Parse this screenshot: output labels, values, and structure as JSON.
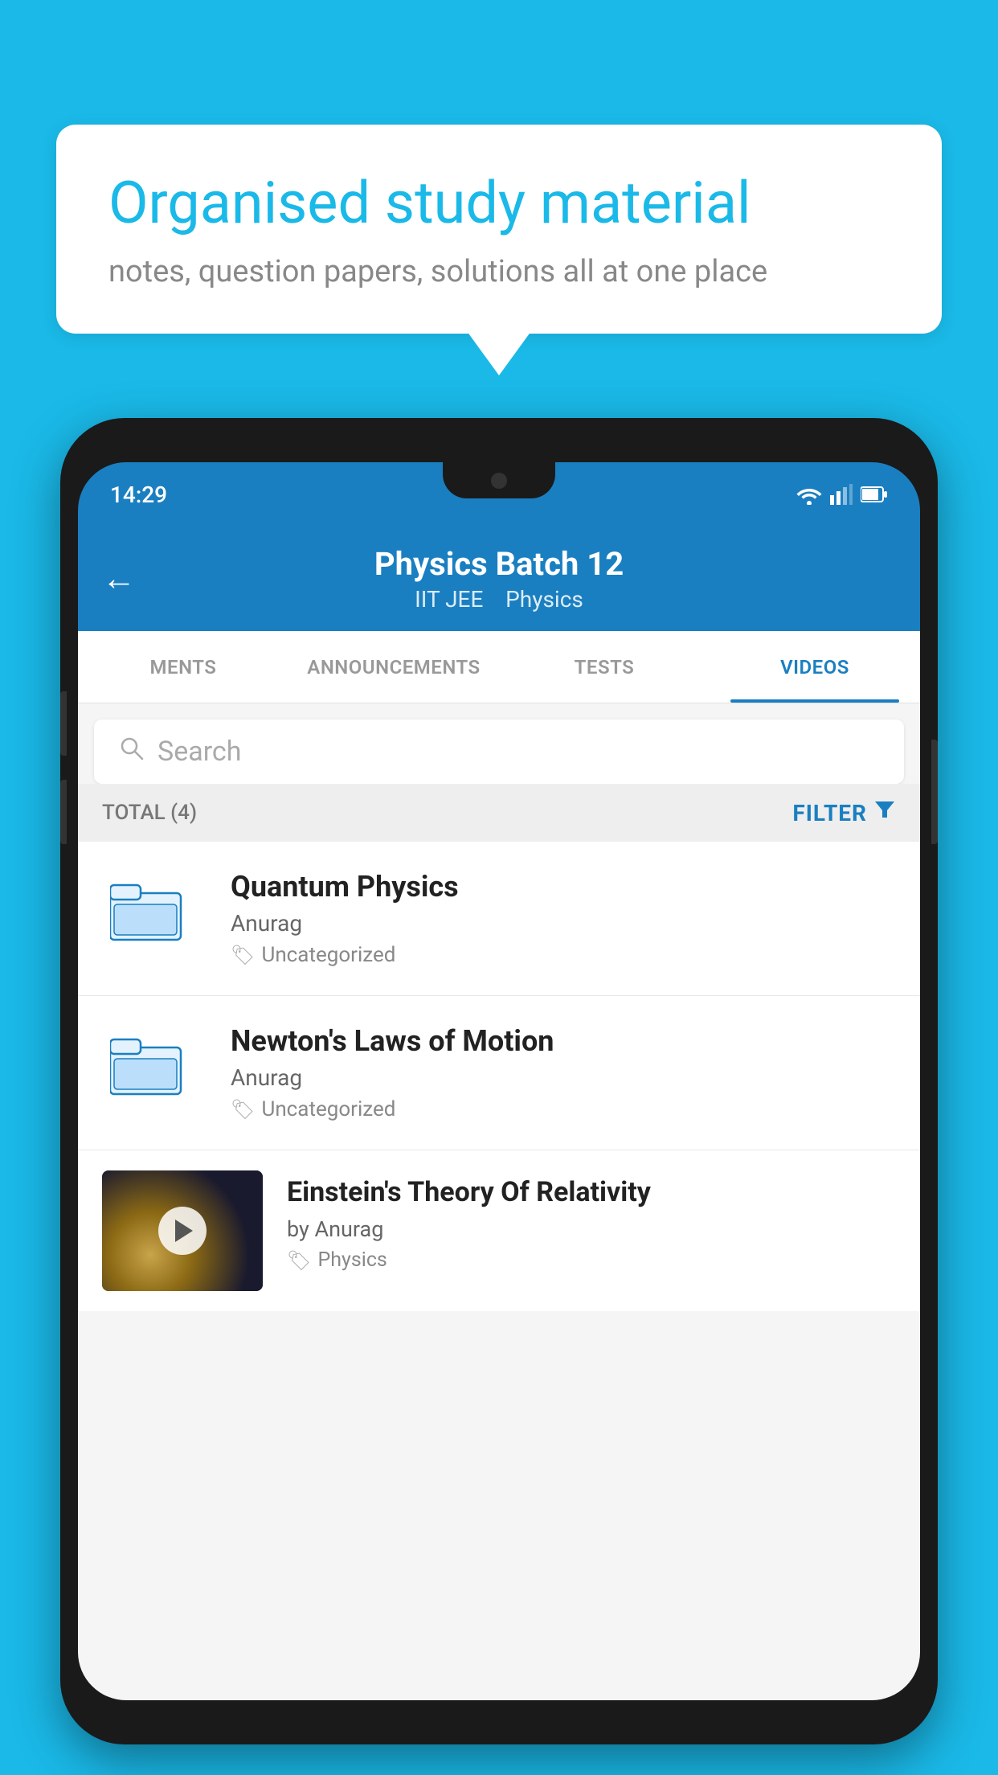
{
  "background": {
    "color": "#1ab9e8"
  },
  "bubble": {
    "title": "Organised study material",
    "subtitle": "notes, question papers, solutions all at one place"
  },
  "phone": {
    "status_bar": {
      "time": "14:29"
    },
    "header": {
      "title": "Physics Batch 12",
      "subtitle_part1": "IIT JEE",
      "subtitle_part2": "Physics",
      "back_arrow": "←"
    },
    "tabs": [
      {
        "label": "MENTS",
        "active": false
      },
      {
        "label": "ANNOUNCEMENTS",
        "active": false
      },
      {
        "label": "TESTS",
        "active": false
      },
      {
        "label": "VIDEOS",
        "active": true
      }
    ],
    "search": {
      "placeholder": "Search"
    },
    "filter_row": {
      "total_label": "TOTAL (4)",
      "filter_label": "FILTER"
    },
    "videos": [
      {
        "id": "quantum",
        "title": "Quantum Physics",
        "author": "Anurag",
        "tag": "Uncategorized",
        "type": "folder"
      },
      {
        "id": "newton",
        "title": "Newton's Laws of Motion",
        "author": "Anurag",
        "tag": "Uncategorized",
        "type": "folder"
      },
      {
        "id": "einstein",
        "title": "Einstein's Theory Of Relativity",
        "author": "by Anurag",
        "tag": "Physics",
        "type": "video"
      }
    ]
  }
}
